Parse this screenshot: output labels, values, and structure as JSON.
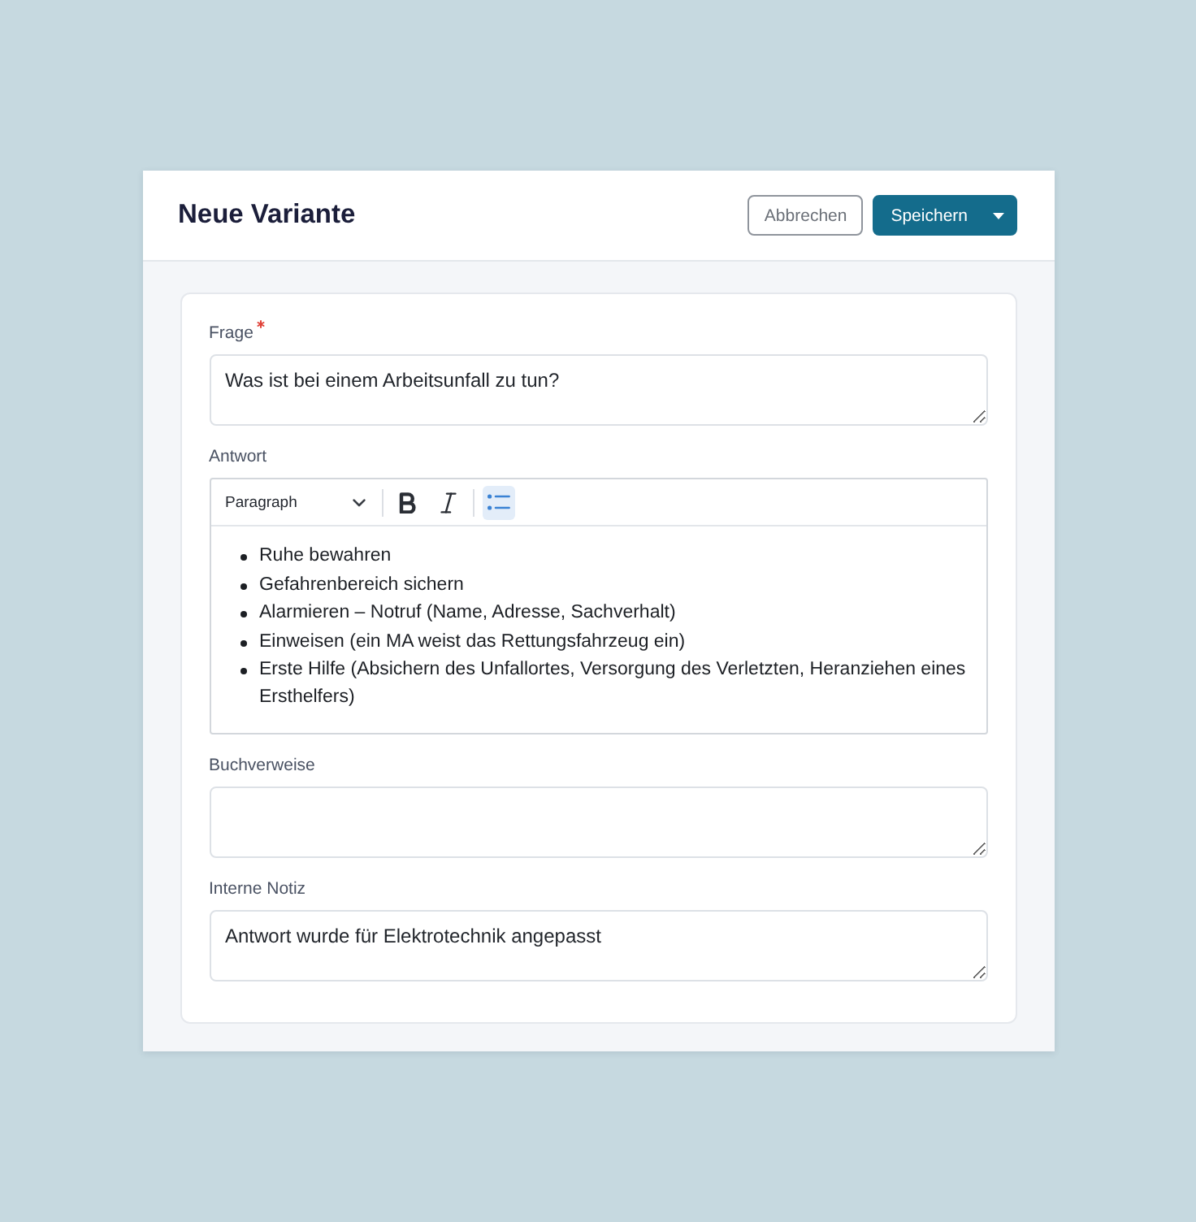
{
  "dialog": {
    "title": "Neue Variante",
    "actions": [
      {
        "kind": "secondary",
        "label": "Abbrechen"
      },
      {
        "kind": "primary",
        "label": "Speichern",
        "menu": true
      }
    ]
  },
  "form": {
    "fields": [
      {
        "kind": "textarea",
        "label": "Frage",
        "required": true,
        "value": "Was ist bei einem Arbeitsunfall zu tun?"
      },
      {
        "kind": "editor",
        "label": "Antwort",
        "required": false,
        "toolbar": {
          "block_format": "Paragraph",
          "buttons": [
            {
              "kind": "bold",
              "selected": false
            },
            {
              "kind": "italic",
              "selected": false
            },
            {
              "kind": "bullet-list",
              "selected": true
            }
          ]
        },
        "items": [
          "Ruhe bewahren",
          "Gefahrenbereich sichern",
          "Alarmieren – Notruf (Name, Adresse, Sachverhalt)",
          "Einweisen (ein MA weist das Rettungsfahrzeug ein)",
          "Erste Hilfe (Absichern des Unfallortes, Versorgung des Verletzten, Heranziehen eines Ersthelfers)"
        ]
      },
      {
        "kind": "textarea",
        "label": "Buchverweise",
        "required": false
      },
      {
        "kind": "textarea",
        "label": "Interne Notiz",
        "required": false,
        "value": "Antwort wurde für Elektrotechnik angepasst"
      }
    ]
  }
}
